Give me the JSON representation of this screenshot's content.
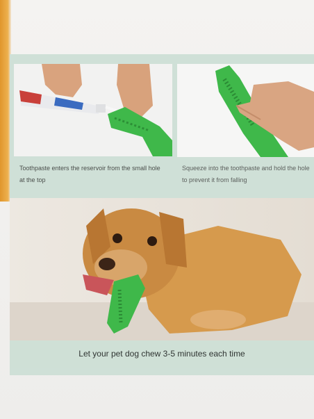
{
  "captions": {
    "left": "Toothpaste enters the reservoir from the small hole at the top",
    "right": "Squeeze into the toothpaste and hold the hole to prevent it from falling",
    "bottom": "Let your pet dog chew 3-5 minutes each time"
  },
  "colors": {
    "panel_green": "#cfe0d7",
    "toothbrush_green": "#3fb84a",
    "device_edge_orange": "#e0962c"
  }
}
